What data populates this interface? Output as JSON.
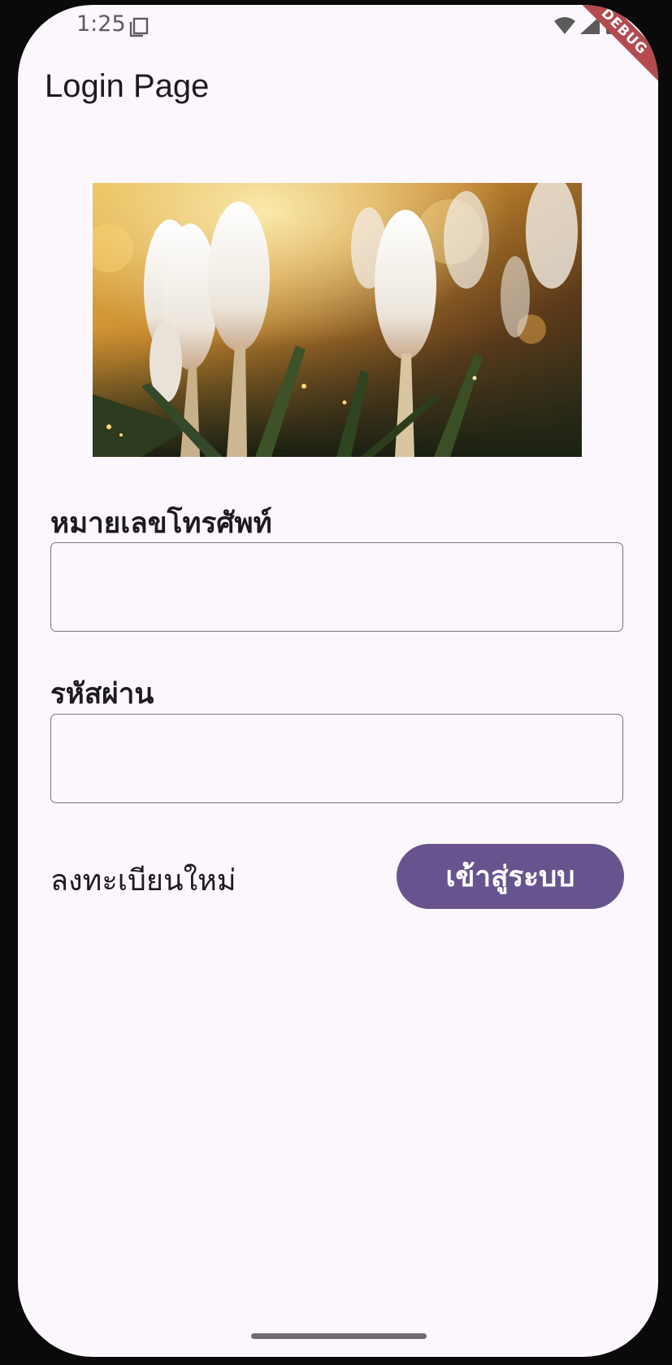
{
  "status_bar": {
    "time": "1:25",
    "icons": [
      "copy-icon",
      "wifi-icon",
      "signal-icon",
      "battery-icon"
    ]
  },
  "debug_banner": "DEBUG",
  "app_bar": {
    "title": "Login Page"
  },
  "hero_image": {
    "subject": "white crocus flowers with raindrops"
  },
  "form": {
    "phone_label": "หมายเลขโทรศัพท์",
    "phone_value": "",
    "password_label": "รหัสผ่าน",
    "password_value": ""
  },
  "actions": {
    "register_label": "ลงทะเบียนใหม่",
    "login_label": "เข้าสู่ระบบ"
  },
  "colors": {
    "background": "#fcf7fd",
    "primary": "#67548e",
    "outline": "#79747e",
    "debug": "#b24a4f"
  }
}
